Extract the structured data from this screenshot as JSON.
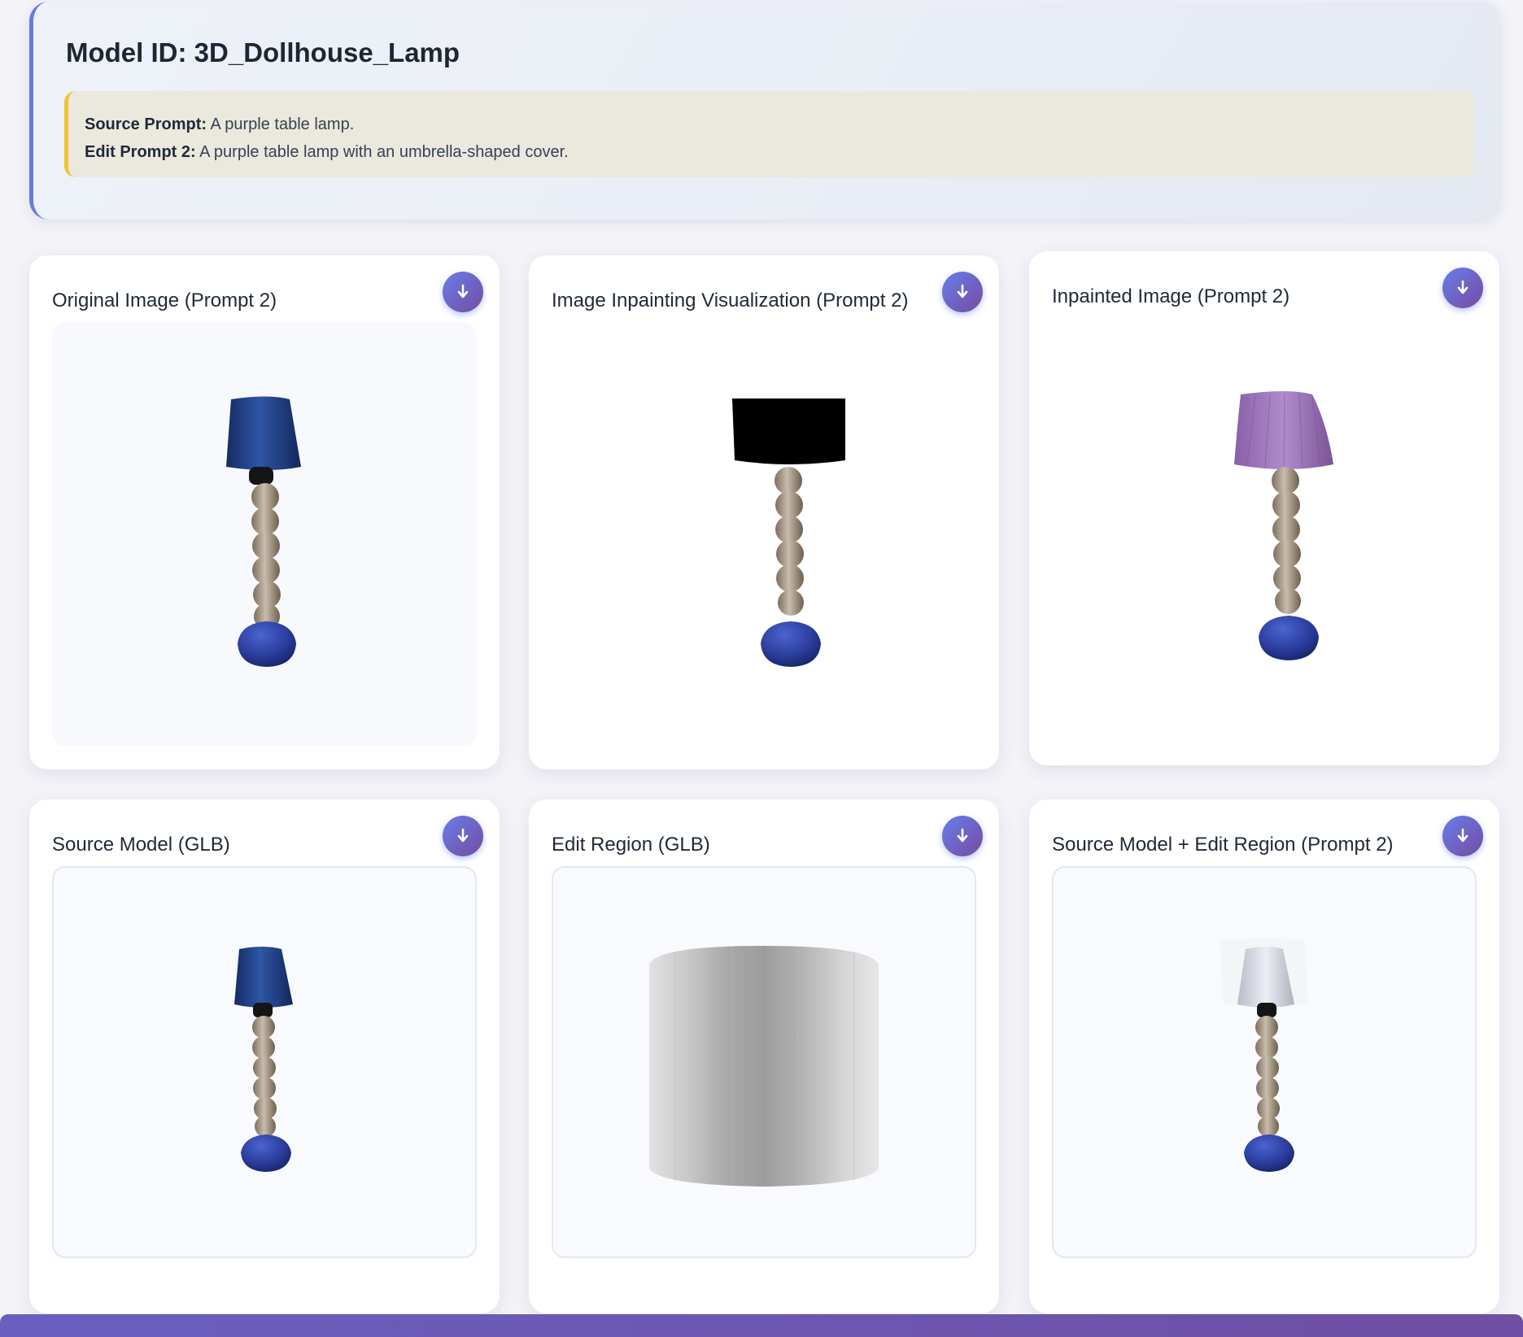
{
  "header": {
    "model_id": "Model ID: 3D_Dollhouse_Lamp",
    "source_prompt_label": "Source Prompt:",
    "source_prompt_text": "A purple table lamp.",
    "edit_prompt_label": "Edit Prompt 2:",
    "edit_prompt_text": "A purple table lamp with an umbrella-shaped cover."
  },
  "cards": [
    {
      "title": "Original Image (Prompt 2)",
      "button": "download-icon"
    },
    {
      "title": "Image Inpainting Visualization (Prompt 2)",
      "button": "download-icon"
    },
    {
      "title": "Inpainted Image (Prompt 2)",
      "button": "download-icon"
    },
    {
      "title": "Source Model (GLB)",
      "button": "download-icon"
    },
    {
      "title": "Edit Region (GLB)",
      "button": "download-icon"
    },
    {
      "title": "Source Model + Edit Region (Prompt 2)",
      "button": "download-icon"
    }
  ],
  "colors": {
    "accent": "#667eea",
    "accent_end": "#764ba2",
    "prompt_border": "#f2c230",
    "lamp_shade_blue": "#1f3f8a",
    "lamp_shade_purple": "#9a72b8",
    "lamp_base_blue": "#2b3fa0",
    "lamp_stem": "#b9ab98"
  }
}
